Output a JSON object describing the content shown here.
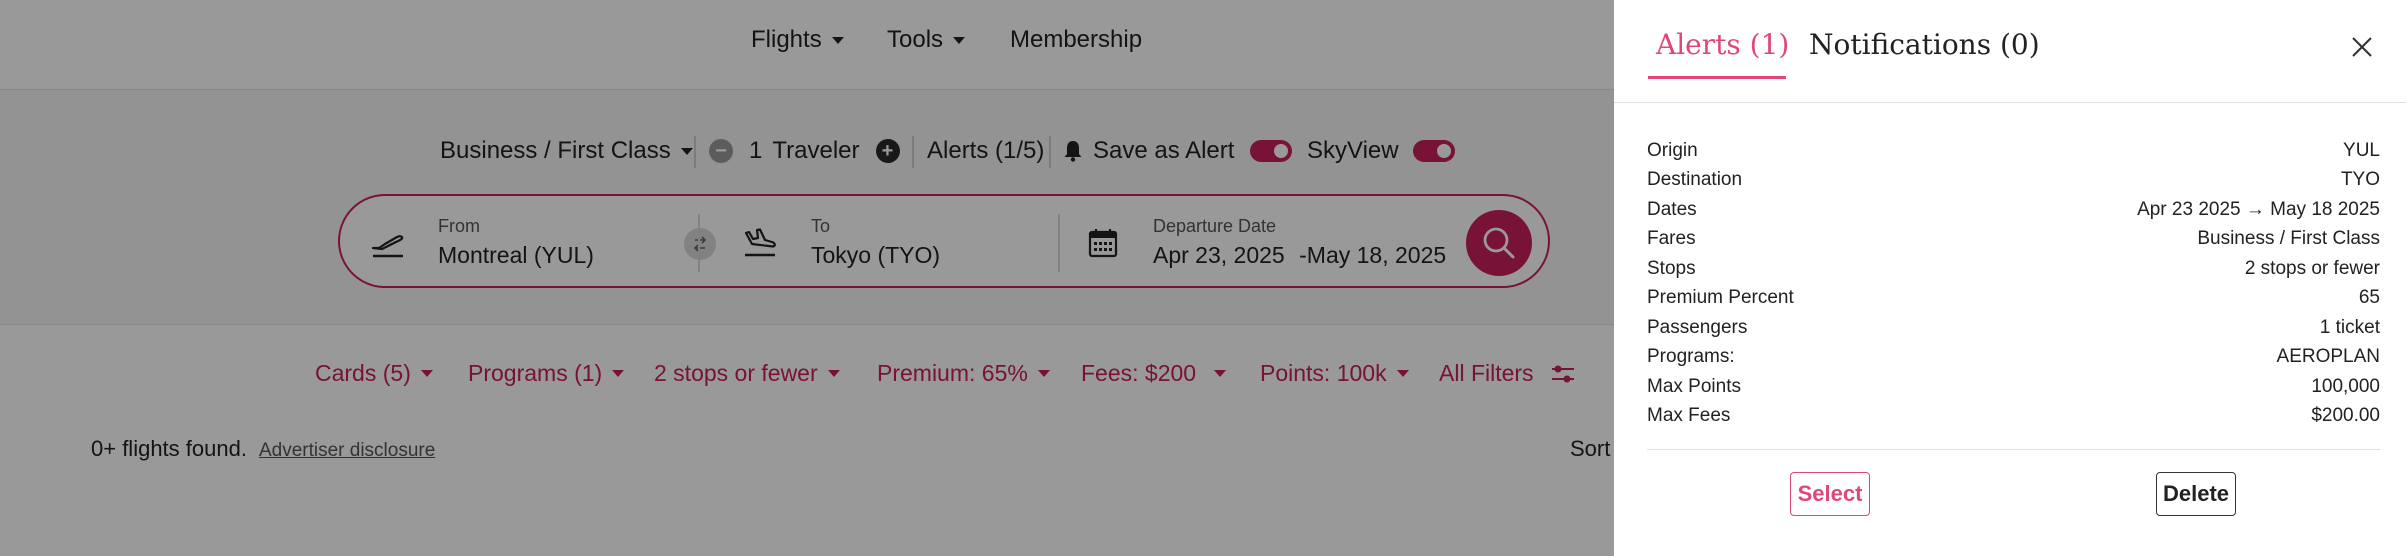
{
  "nav": {
    "flights": "Flights",
    "tools": "Tools",
    "membership": "Membership"
  },
  "options": {
    "cabin": "Business / First Class",
    "traveler_count": "1",
    "traveler_label": "Traveler",
    "alerts": "Alerts (1/5)",
    "save_alert": "Save as Alert",
    "skyview": "SkyView"
  },
  "search": {
    "from_label": "From",
    "from_value": "Montreal (YUL)",
    "to_label": "To",
    "to_value": "Tokyo (TYO)",
    "date_label": "Departure Date",
    "date_start": "Apr 23, 2025",
    "date_sep": "-",
    "date_end": "May 18, 2025"
  },
  "filters": {
    "cards": "Cards (5)",
    "programs": "Programs (1)",
    "stops": "2 stops or fewer",
    "premium": "Premium: 65%",
    "fees": "Fees: $200",
    "points": "Points: 100k",
    "all": "All Filters"
  },
  "results": {
    "count": "0+ flights found.",
    "disclosure": "Advertiser disclosure",
    "sort": "Sort"
  },
  "panel": {
    "tab_alerts": "Alerts (1)",
    "tab_notifications": "Notifications (0)",
    "details": [
      {
        "label": "Origin",
        "value": "YUL"
      },
      {
        "label": "Destination",
        "value": "TYO"
      },
      {
        "label": "Dates",
        "value": "Apr 23 2025 → May 18 2025"
      },
      {
        "label": "Fares",
        "value": "Business / First Class"
      },
      {
        "label": "Stops",
        "value": "2 stops or fewer"
      },
      {
        "label": "Premium Percent",
        "value": "65"
      },
      {
        "label": "Passengers",
        "value": "1 ticket"
      },
      {
        "label": "Programs:",
        "value": "AEROPLAN"
      },
      {
        "label": "Max Points",
        "value": "100,000"
      },
      {
        "label": "Max Fees",
        "value": "$200.00"
      }
    ],
    "select_label": "Select",
    "delete_label": "Delete"
  },
  "colors": {
    "accent": "#c81e5a",
    "panel_accent": "#e0457b",
    "overlay": "rgba(0,0,0,0.4)"
  }
}
